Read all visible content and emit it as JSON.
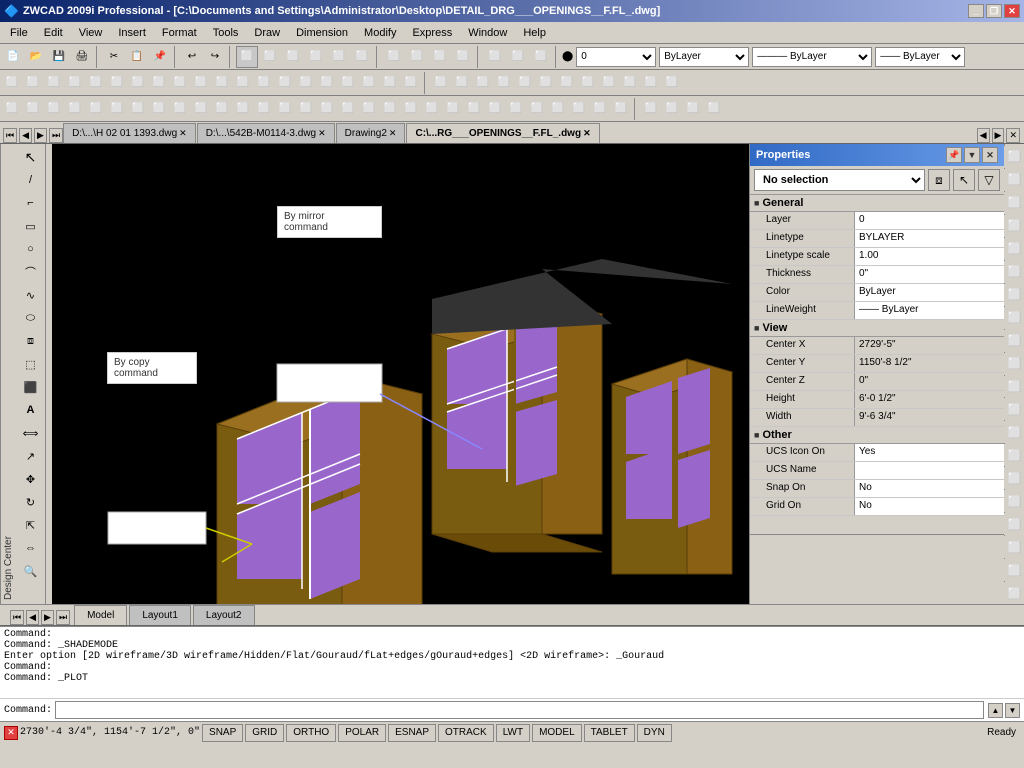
{
  "titlebar": {
    "title": "ZWCAD 2009i Professional - [C:\\Documents and Settings\\Administrator\\Desktop\\DETAIL_DRG___OPENINGS__F.FL_.dwg]",
    "app_icon": "zwcad-icon"
  },
  "menubar": {
    "items": [
      "File",
      "Edit",
      "View",
      "Insert",
      "Format",
      "Tools",
      "Draw",
      "Dimension",
      "Modify",
      "Express",
      "Window",
      "Help"
    ]
  },
  "toolbar1": {
    "layer_value": "0",
    "color_value": "ByLayer",
    "linetype_value": "ByLayer",
    "lineweight_value": "ByLayer"
  },
  "tabs": {
    "docs": [
      {
        "label": "D:\\...\\H 02 01 1393.dwg",
        "active": false
      },
      {
        "label": "D:\\...\\542B-M0114-3.dwg",
        "active": false
      },
      {
        "label": "Drawing2",
        "active": false
      },
      {
        "label": "C:\\...RG___OPENINGS__F.FL_.dwg",
        "active": true
      }
    ]
  },
  "canvas": {
    "annotation1": {
      "text_line1": "By mirror",
      "text_line2": "command"
    },
    "annotation2": {
      "text_line1": "By copy",
      "text_line2": "command"
    }
  },
  "properties": {
    "title": "Properties",
    "selection_label": "No selection",
    "sections": {
      "general": {
        "title": "General",
        "rows": [
          {
            "name": "Layer",
            "value": "0"
          },
          {
            "name": "Linetype",
            "value": "BYLAYER"
          },
          {
            "name": "Linetype scale",
            "value": "1.00"
          },
          {
            "name": "Thickness",
            "value": "0\""
          },
          {
            "name": "Color",
            "value": "ByLayer"
          },
          {
            "name": "LineWeight",
            "value": "—— ByLayer"
          }
        ]
      },
      "view": {
        "title": "View",
        "rows": [
          {
            "name": "Center X",
            "value": "2729'-5\""
          },
          {
            "name": "Center Y",
            "value": "1150'-8 1/2\""
          },
          {
            "name": "Center Z",
            "value": "0\""
          },
          {
            "name": "Height",
            "value": "6'-0 1/2\""
          },
          {
            "name": "Width",
            "value": "9'-6 3/4\""
          }
        ]
      },
      "other": {
        "title": "Other",
        "rows": [
          {
            "name": "UCS Icon On",
            "value": "Yes"
          },
          {
            "name": "UCS Name",
            "value": ""
          },
          {
            "name": "Snap On",
            "value": "No"
          },
          {
            "name": "Grid On",
            "value": "No"
          }
        ]
      }
    }
  },
  "bottom_tabs": {
    "items": [
      "Model",
      "Layout1",
      "Layout2"
    ]
  },
  "command_bar": {
    "lines": [
      "Command:",
      "Command: _SHADEMODE",
      "Enter option [2D wireframe/3D wireframe/Hidden/Flat/Gouraud/fLat+edges/gOuraud+edges] <2D wireframe>: _Gouraud",
      "Command:",
      "Command: _PLOT"
    ],
    "input_label": "Command:"
  },
  "statusbar": {
    "coords": "2730'-4 3/4\",  1154'-7 1/2\",  0\"",
    "buttons": [
      "SNAP",
      "GRID",
      "ORTHO",
      "POLAR",
      "ESNAP",
      "OTRACK",
      "LWT",
      "MODEL",
      "TABLET",
      "DYN"
    ],
    "active_buttons": [],
    "status": "Ready"
  }
}
